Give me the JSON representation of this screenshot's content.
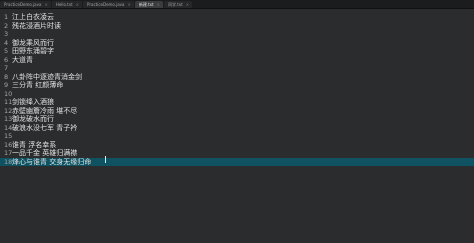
{
  "tabs": [
    {
      "label": "PracticeDemo.java",
      "active": false
    },
    {
      "label": "Hello.txt",
      "active": false
    },
    {
      "label": "PracticeDemo.java",
      "active": false
    },
    {
      "label": "新建.txt",
      "active": true
    },
    {
      "label": "同学.txt",
      "active": false
    }
  ],
  "tab_close_glyph": "×",
  "lines": [
    {
      "num": "1",
      "text": "江上白衣凌云"
    },
    {
      "num": "2",
      "text": "残花浸酒片时读"
    },
    {
      "num": "3",
      "text": ""
    },
    {
      "num": "4",
      "text": "御龙乘风而行"
    },
    {
      "num": "5",
      "text": "田野东涌碧字"
    },
    {
      "num": "6",
      "text": "大道青"
    },
    {
      "num": "7",
      "text": ""
    },
    {
      "num": "8",
      "text": "八卦阵中逐迹青消金剑"
    },
    {
      "num": "9",
      "text": "三分青 红颜薄命"
    },
    {
      "num": "10",
      "text": ""
    },
    {
      "num": "11",
      "text": "剑锁绛入酒狼"
    },
    {
      "num": "12",
      "text": "赤壁幽簷冷雨 堪不尽"
    },
    {
      "num": "13",
      "text": "御龙破水而行"
    },
    {
      "num": "14",
      "text": "破浪水没七军 青子衿"
    },
    {
      "num": "15",
      "text": ""
    },
    {
      "num": "16",
      "text": "谁青 浮名幸系"
    },
    {
      "num": "17",
      "text": "一品千金 英雄归满襟"
    },
    {
      "num": "18",
      "text": "烽心与谁青 交身无缘归命"
    }
  ],
  "current_line": 18,
  "colors": {
    "background": "#2a2c2d",
    "tabbar": "#1b1c1d",
    "current_line_highlight": "#0f5262",
    "text": "#e4e4e4",
    "gutter_text": "#a7a7a7"
  }
}
